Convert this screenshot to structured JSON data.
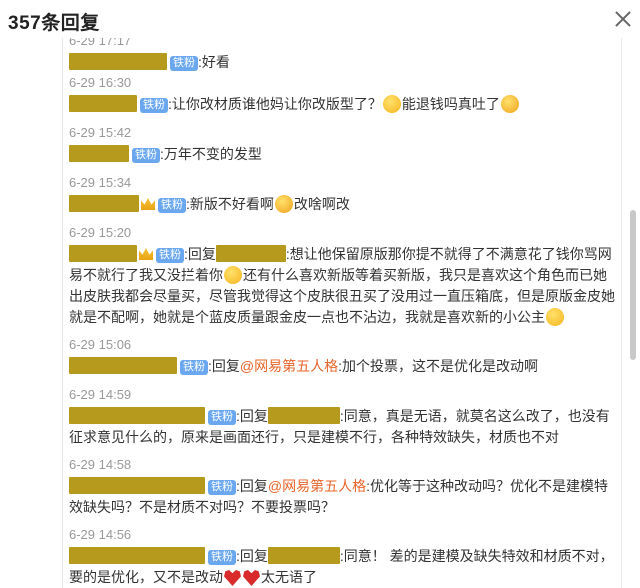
{
  "header": {
    "title": "357条回复"
  },
  "badge_text": "铁粉",
  "comments": [
    {
      "time": "6-29 17:17",
      "text": ":好看"
    },
    {
      "time": "6-29 16:30",
      "text": ":让你改材质谁他妈让你改版型了？",
      "text2": "能退钱吗真吐了"
    },
    {
      "time": "6-29 15:42",
      "text": ":万年不变的发型"
    },
    {
      "time": "6-29 15:34",
      "text": ":新版不好看啊",
      "text2": "改啥啊改"
    },
    {
      "time": "6-29 15:20",
      "reply": ":回复",
      "text": ":想让他保留原版那你提不就得了不满意花了钱你骂网易不就行了我又没拦着你",
      "text2": "还有什么喜欢新版等着买新版，我只是喜欢这个角色而已她出皮肤我都会尽量买，尽管我觉得这个皮肤很丑买了没用过一直压箱底，但是原版金皮她就是不配啊，她就是个蓝皮质量跟金皮一点也不沾边，我就是喜欢新的小公主"
    },
    {
      "time": "6-29 15:06",
      "reply": ":回复",
      "mention": "@网易第五人格",
      "text": ":加个投票，这不是优化是改动啊"
    },
    {
      "time": "6-29 14:59",
      "reply": ":回复",
      "text": ":同意，真是无语，就莫名这么改了，也没有征求意见什么的，原来是画面还行，只是建模不行，各种特效缺失，材质也不对"
    },
    {
      "time": "6-29 14:58",
      "reply": ":回复",
      "mention": "@网易第五人格",
      "text": ":优化等于这种改动吗？优化不是建模特效缺失吗？不是材质不对吗？不要投票吗？"
    },
    {
      "time": "6-29 14:56",
      "reply": ":回复",
      "text": ":同意！ 差的是建模及缺失特效和材质不对，要的是优化，又不是改动",
      "text2": "太无语了"
    }
  ]
}
